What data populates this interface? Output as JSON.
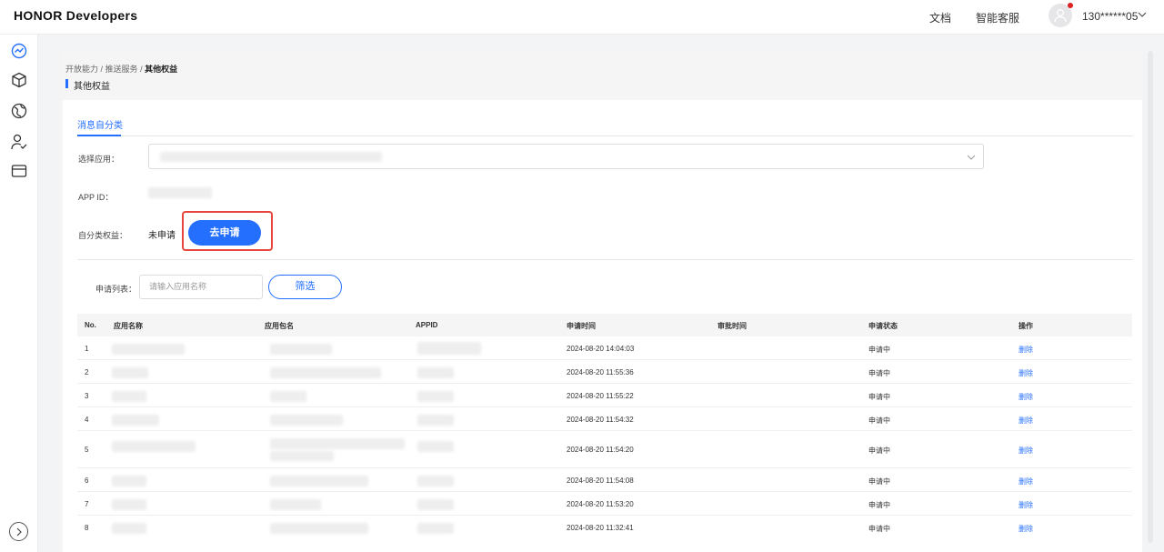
{
  "header": {
    "brand": "HONOR Developers",
    "links": [
      {
        "label": "文档"
      },
      {
        "label": "智能客服"
      }
    ],
    "user": {
      "name": "130******05"
    }
  },
  "breadcrumb": {
    "items": [
      "开放能力",
      "推送服务"
    ],
    "current": "其他权益"
  },
  "page_title": "其他权益",
  "tab": {
    "label": "消息自分类"
  },
  "form": {
    "select_app_label": "选择应用：",
    "app_id_label": "APP ID：",
    "rights_label": "自分类权益：",
    "rights_status": "未申请",
    "apply_button": "去申请"
  },
  "filter": {
    "label": "申请列表：",
    "placeholder": "请输入应用名称",
    "button": "筛选"
  },
  "table": {
    "columns": [
      "No.",
      "应用名称",
      "应用包名",
      "APPID",
      "申请时间",
      "审批时间",
      "申请状态",
      "操作"
    ],
    "rows": [
      {
        "no": "1",
        "time": "2024-08-20 14:04:03",
        "status": "申请中",
        "action": "删除"
      },
      {
        "no": "2",
        "time": "2024-08-20 11:55:36",
        "status": "申请中",
        "action": "删除"
      },
      {
        "no": "3",
        "time": "2024-08-20 11:55:22",
        "status": "申请中",
        "action": "删除"
      },
      {
        "no": "4",
        "time": "2024-08-20 11:54:32",
        "status": "申请中",
        "action": "删除"
      },
      {
        "no": "5",
        "time": "2024-08-20 11:54:20",
        "status": "申请中",
        "action": "删除"
      },
      {
        "no": "6",
        "time": "2024-08-20 11:54:08",
        "status": "申请中",
        "action": "删除"
      },
      {
        "no": "7",
        "time": "2024-08-20 11:53:20",
        "status": "申请中",
        "action": "删除"
      },
      {
        "no": "8",
        "time": "2024-08-20 11:32:41",
        "status": "申请中",
        "action": "删除"
      }
    ]
  },
  "colors": {
    "accent": "#256fff",
    "highlight": "#e8453c",
    "notification": "#e02020"
  }
}
